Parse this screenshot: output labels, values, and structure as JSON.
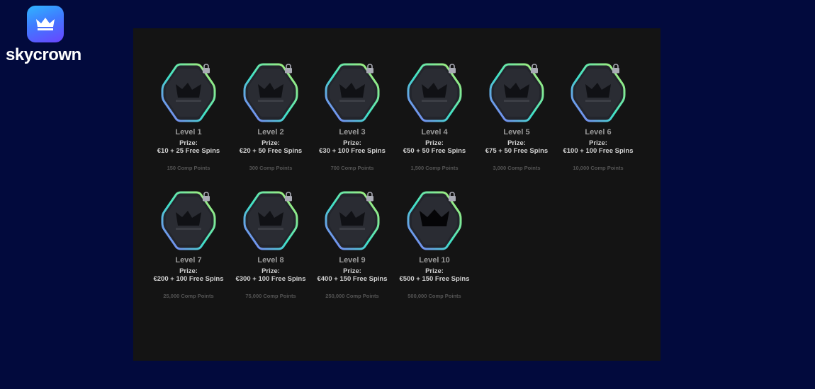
{
  "brand": {
    "name": "skycrown",
    "logo_icon": "crown-icon"
  },
  "colors": {
    "page_background": "#020a3d",
    "panel_background": "#141414",
    "badge_fill": "#23252c",
    "badge_gradient": [
      "#b8f06a",
      "#3fe0c8",
      "#8a6cff"
    ],
    "lock": "#a9aab4"
  },
  "levels": [
    {
      "title": "Level 1",
      "prize_label": "Prize:",
      "prize": "€10 + 25 Free Spins",
      "points": "150 Comp Points",
      "icon": "crown-icon",
      "locked": true
    },
    {
      "title": "Level 2",
      "prize_label": "Prize:",
      "prize": "€20 + 50 Free Spins",
      "points": "300 Comp Points",
      "icon": "crown-icon",
      "locked": true
    },
    {
      "title": "Level 3",
      "prize_label": "Prize:",
      "prize": "€30 + 100 Free Spins",
      "points": "700 Comp Points",
      "icon": "crown-icon",
      "locked": true
    },
    {
      "title": "Level 4",
      "prize_label": "Prize:",
      "prize": "€50 + 50 Free Spins",
      "points": "1,500 Comp Points",
      "icon": "crown-icon",
      "locked": true
    },
    {
      "title": "Level 5",
      "prize_label": "Prize:",
      "prize": "€75 + 50 Free Spins",
      "points": "3,000 Comp Points",
      "icon": "crown-icon",
      "locked": true
    },
    {
      "title": "Level 6",
      "prize_label": "Prize:",
      "prize": "€100 + 100 Free Spins",
      "points": "10,000 Comp Points",
      "icon": "crown-icon",
      "locked": true
    },
    {
      "title": "Level 7",
      "prize_label": "Prize:",
      "prize": "€200 + 100 Free Spins",
      "points": "25,000 Comp Points",
      "icon": "crown-icon",
      "locked": true
    },
    {
      "title": "Level 8",
      "prize_label": "Prize:",
      "prize": "€300 + 100 Free Spins",
      "points": "75,000 Comp Points",
      "icon": "crown-icon",
      "locked": true
    },
    {
      "title": "Level 9",
      "prize_label": "Prize:",
      "prize": "€400 + 150 Free Spins",
      "points": "250,000 Comp Points",
      "icon": "crown-icon",
      "locked": true
    },
    {
      "title": "Level 10",
      "prize_label": "Prize:",
      "prize": "€500 + 150 Free Spins",
      "points": "500,000 Comp Points",
      "icon": "large-crown-icon",
      "locked": true
    }
  ]
}
